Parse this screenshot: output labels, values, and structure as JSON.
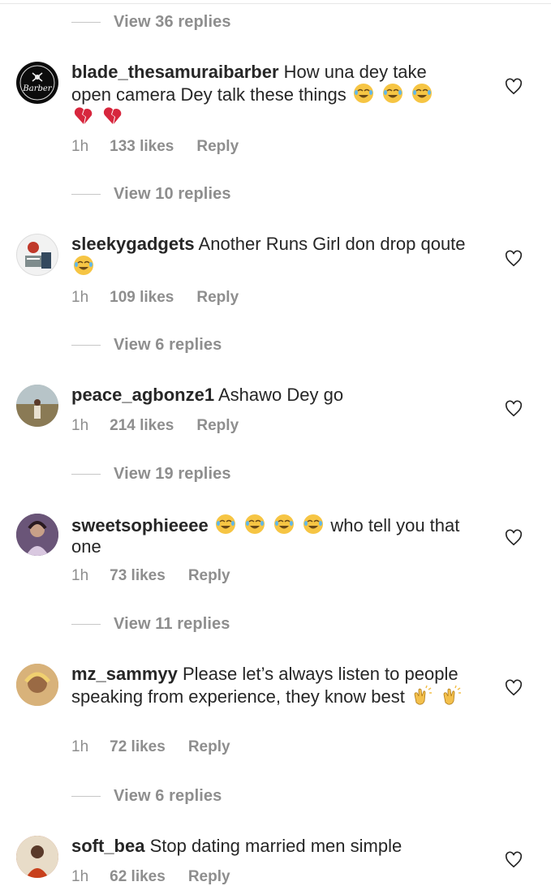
{
  "view_replies": [
    {
      "label": "View 36 replies"
    },
    {
      "label": "View 10 replies"
    },
    {
      "label": "View 6 replies"
    },
    {
      "label": "View 19 replies"
    },
    {
      "label": "View 11 replies"
    },
    {
      "label": "View 6 replies"
    }
  ],
  "comments": [
    {
      "username": "blade_thesamuraibarber",
      "text": "How una dey take open camera Dey talk these things",
      "time": "1h",
      "likes": "133 likes",
      "reply": "Reply",
      "avatar_icon": "samurai-barber-logo"
    },
    {
      "username": "sleekygadgets",
      "text": "Another Runs Girl don drop qoute",
      "time": "1h",
      "likes": "109 likes",
      "reply": "Reply",
      "avatar_icon": "gadget-store-logo"
    },
    {
      "username": "peace_agbonze1",
      "text": "Ashawo Dey go",
      "time": "1h",
      "likes": "214 likes",
      "reply": "Reply",
      "avatar_icon": "person-photo"
    },
    {
      "username": "sweetsophieeee",
      "text": "who tell you that one",
      "time": "1h",
      "likes": "73 likes",
      "reply": "Reply",
      "avatar_icon": "person-photo"
    },
    {
      "username": "mz_sammyy",
      "text": "Please let’s always listen to people speaking from experience, they know best",
      "time": "1h",
      "likes": "72 likes",
      "reply": "Reply",
      "avatar_icon": "person-photo"
    },
    {
      "username": "soft_bea",
      "text": "Stop dating married men simple",
      "time": "1h",
      "likes": "62 likes",
      "reply": "Reply",
      "avatar_icon": "person-photo"
    }
  ],
  "avatar_logo_text": "Barber",
  "colors": {
    "text": "#262626",
    "muted": "#8e8e8e",
    "divider": "#c7c7c7",
    "background": "#ffffff"
  }
}
